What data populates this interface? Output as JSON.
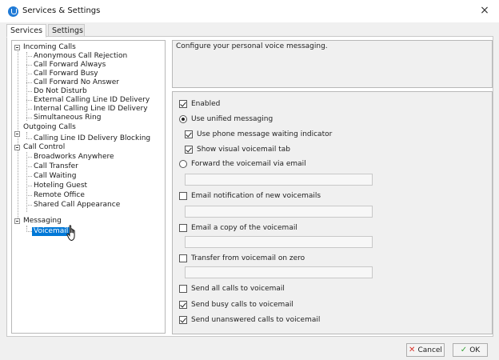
{
  "window": {
    "title": "Services & Settings",
    "icon": "app-logo-icon",
    "close_glyph": "×"
  },
  "tabs": [
    {
      "label": "Services"
    },
    {
      "label": "Settings"
    }
  ],
  "tree": {
    "incoming": {
      "label": "Incoming Calls",
      "children": [
        "Anonymous Call Rejection",
        "Call Forward Always",
        "Call Forward Busy",
        "Call Forward No Answer",
        "Do Not Disturb",
        "External Calling Line ID Delivery",
        "Internal Calling Line ID Delivery",
        "Simultaneous Ring"
      ]
    },
    "outgoing": {
      "label": "Outgoing Calls",
      "children": [
        "Calling Line ID Delivery Blocking"
      ]
    },
    "control": {
      "label": "Call Control",
      "children": [
        "Broadworks Anywhere",
        "Call Transfer",
        "Call Waiting",
        "Hoteling Guest",
        "Remote Office",
        "Shared Call Appearance"
      ]
    },
    "messaging": {
      "label": "Messaging",
      "children": [
        "Voicemail"
      ]
    }
  },
  "description": "Configure your personal voice messaging.",
  "options": {
    "enabled": {
      "label": "Enabled",
      "checked": true
    },
    "use_unified": {
      "label": "Use unified messaging",
      "checked": true
    },
    "waiting_indicator": {
      "label": "Use phone message waiting indicator",
      "checked": true
    },
    "visual_tab": {
      "label": "Show visual voicemail tab",
      "checked": true
    },
    "forward_email": {
      "label": "Forward the voicemail via email",
      "checked": false,
      "value": ""
    },
    "email_notification": {
      "label": "Email notification of new voicemails",
      "checked": false,
      "value": ""
    },
    "email_copy": {
      "label": "Email a copy of the voicemail",
      "checked": false,
      "value": ""
    },
    "transfer_zero": {
      "label": "Transfer from voicemail on zero",
      "checked": false,
      "value": ""
    },
    "send_all": {
      "label": "Send all calls to voicemail",
      "checked": false
    },
    "send_busy": {
      "label": "Send busy calls to voicemail",
      "checked": true
    },
    "send_unanswered": {
      "label": "Send unanswered calls to voicemail",
      "checked": true
    }
  },
  "buttons": {
    "cancel": {
      "label": "Cancel",
      "icon_color": "#d9342b"
    },
    "ok": {
      "label": "OK",
      "icon_color": "#3aa53a"
    }
  }
}
